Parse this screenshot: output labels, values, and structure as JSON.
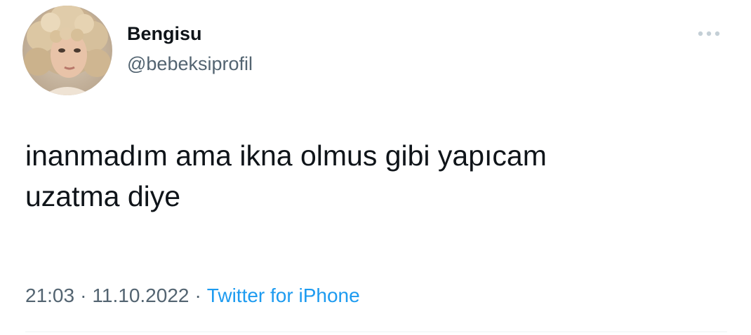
{
  "author": {
    "display_name": "Bengisu",
    "handle": "@bebeksiprofil",
    "avatar_icon": "profile-photo"
  },
  "tweet": {
    "text_lines": [
      "inanmadım ama ikna olmus gibi yapıcam",
      "uzatma diye"
    ]
  },
  "meta": {
    "time": "21:03",
    "date": "11.10.2022",
    "separator": "·",
    "source": "Twitter for iPhone"
  },
  "menu": {
    "icon": "more-options-icon"
  },
  "colors": {
    "text": "#0f1419",
    "secondary": "#536471",
    "link": "#1d9bf0",
    "divider": "#eff3f4"
  }
}
